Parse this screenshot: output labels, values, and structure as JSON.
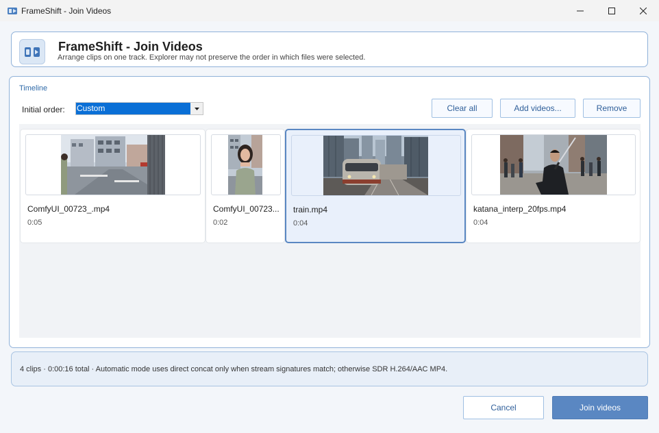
{
  "window": {
    "title": "FrameShift - Join Videos",
    "controls": [
      "minimize-icon",
      "maximize-icon",
      "close-icon"
    ]
  },
  "header": {
    "title": "FrameShift - Join Videos",
    "subtitle": "Arrange clips on one track. Explorer may not preserve the order in which files were selected.",
    "icon": "join-videos-icon"
  },
  "timeline": {
    "label": "Timeline",
    "order_label": "Initial order:",
    "order_value": "Custom",
    "buttons": {
      "clear_all": "Clear all",
      "add_videos": "Add videos...",
      "remove": "Remove"
    },
    "clips": [
      {
        "name": "ComfyUI_00723_.mp4",
        "duration": "0:05",
        "selected": false,
        "thumb": "street-woman-wide"
      },
      {
        "name": "ComfyUI_00723...",
        "duration": "0:02",
        "selected": false,
        "thumb": "street-woman-portrait"
      },
      {
        "name": "train.mp4",
        "duration": "0:04",
        "selected": true,
        "thumb": "city-train"
      },
      {
        "name": "katana_interp_20fps.mp4",
        "duration": "0:04",
        "selected": false,
        "thumb": "katana-street"
      }
    ]
  },
  "status": {
    "text": "4 clips · 0:00:16 total · Automatic mode uses direct concat only when stream signatures match; otherwise SDR H.264/AAC MP4."
  },
  "footer": {
    "cancel": "Cancel",
    "join": "Join videos"
  },
  "colors": {
    "accent": "#5a87c2",
    "panel_border": "#8fb1d9",
    "selection": "#0a6fd6",
    "link_text": "#2f5f9a"
  }
}
